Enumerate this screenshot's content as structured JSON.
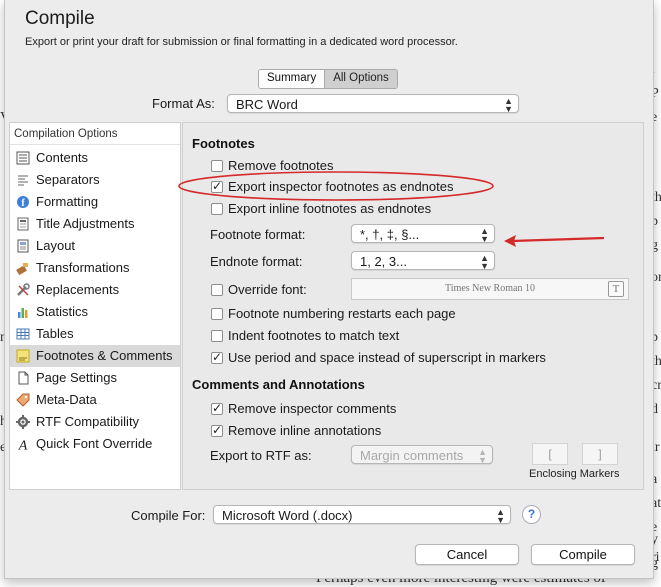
{
  "background_doc": {
    "right_fragments": [
      "l",
      "P",
      "e",
      "th",
      "p",
      "g",
      "or",
      "p",
      "th",
      "cr",
      "d",
      "ir",
      "a",
      "at",
      "e",
      "y",
      "ri",
      "g"
    ],
    "left_fragments": [
      "V",
      "",
      "n",
      "",
      "h",
      "e"
    ],
    "bottom_text": "Perhaps even more interesting were estimates of"
  },
  "dialog": {
    "title": "Compile",
    "subtitle": "Export or print your draft for submission or final formatting in a dedicated word processor.",
    "tabs": [
      {
        "label": "Summary"
      },
      {
        "label": "All Options"
      }
    ],
    "format_as": {
      "label": "Format As:",
      "value": "BRC Word"
    }
  },
  "sidebar": {
    "header": "Compilation Options",
    "items": [
      {
        "label": "Contents",
        "icon": "contents-icon"
      },
      {
        "label": "Separators",
        "icon": "separators-icon"
      },
      {
        "label": "Formatting",
        "icon": "formatting-icon"
      },
      {
        "label": "Title Adjustments",
        "icon": "title-adjustments-icon"
      },
      {
        "label": "Layout",
        "icon": "layout-icon"
      },
      {
        "label": "Transformations",
        "icon": "transformations-icon"
      },
      {
        "label": "Replacements",
        "icon": "replacements-icon"
      },
      {
        "label": "Statistics",
        "icon": "statistics-icon"
      },
      {
        "label": "Tables",
        "icon": "tables-icon"
      },
      {
        "label": "Footnotes & Comments",
        "icon": "footnotes-icon",
        "selected": true
      },
      {
        "label": "Page Settings",
        "icon": "page-settings-icon"
      },
      {
        "label": "Meta-Data",
        "icon": "meta-data-icon"
      },
      {
        "label": "RTF Compatibility",
        "icon": "rtf-compatibility-icon"
      },
      {
        "label": "Quick Font Override",
        "icon": "quick-font-override-icon"
      }
    ]
  },
  "footnotes": {
    "heading": "Footnotes",
    "remove_footnotes": {
      "label": "Remove footnotes",
      "checked": false
    },
    "export_inspector": {
      "label": "Export inspector footnotes as endnotes",
      "checked": true
    },
    "export_inline": {
      "label": "Export inline footnotes as endnotes",
      "checked": false
    },
    "footnote_format": {
      "label": "Footnote format:",
      "value": "*, †, ‡, §..."
    },
    "endnote_format": {
      "label": "Endnote format:",
      "value": "1, 2, 3..."
    },
    "override_font": {
      "label": "Override font:",
      "checked": false,
      "font_value": "Times New Roman 10",
      "button": "T"
    },
    "numbering_restarts": {
      "label": "Footnote numbering restarts each page",
      "checked": false
    },
    "indent_footnotes": {
      "label": "Indent footnotes to match text",
      "checked": false
    },
    "period_space": {
      "label": "Use period and space instead of superscript in markers",
      "checked": true
    }
  },
  "comments": {
    "heading": "Comments and Annotations",
    "remove_inspector": {
      "label": "Remove inspector comments",
      "checked": true
    },
    "remove_inline": {
      "label": "Remove inline annotations",
      "checked": true
    },
    "export_rtf": {
      "label": "Export to RTF as:",
      "value": "Margin comments"
    },
    "marker_open": "[",
    "marker_close": "]",
    "markers_label": "Enclosing Markers"
  },
  "footer": {
    "compile_for": {
      "label": "Compile For:",
      "value": "Microsoft Word (.docx)"
    },
    "help": "?",
    "cancel": "Cancel",
    "compile": "Compile"
  },
  "colors": {
    "annotation": "#d42a2a",
    "help_accent": "#3873d6",
    "selected_row": "#d9d9d9"
  }
}
